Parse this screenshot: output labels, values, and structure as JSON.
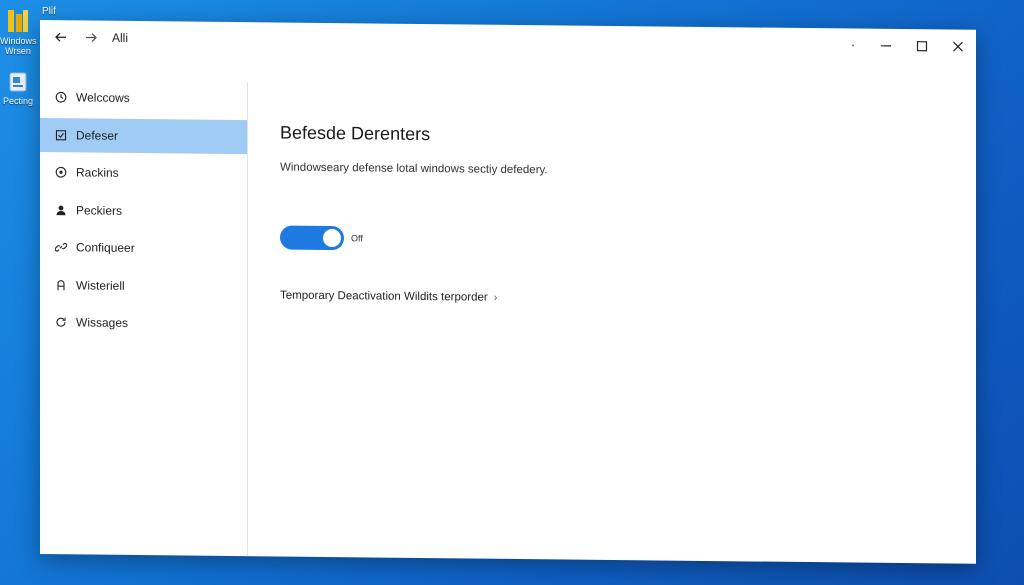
{
  "desktop": {
    "top_label": "Plif",
    "icons": [
      {
        "label": "Windows Wrsen",
        "icon": "folder-icon"
      },
      {
        "label": "Pecting",
        "icon": "file-icon"
      }
    ]
  },
  "window": {
    "title": "Alli",
    "controls": {
      "minimize": "–",
      "maximize": "☐",
      "close": "✕"
    }
  },
  "sidebar": {
    "items": [
      {
        "label": "Welccows",
        "icon": "clock-icon",
        "active": false
      },
      {
        "label": "Defeser",
        "icon": "shield-icon",
        "active": true
      },
      {
        "label": "Rackins",
        "icon": "target-icon",
        "active": false
      },
      {
        "label": "Peckiers",
        "icon": "person-icon",
        "active": false
      },
      {
        "label": "Confiqueer",
        "icon": "link-icon",
        "active": false
      },
      {
        "label": "Wisteriell",
        "icon": "lock-icon",
        "active": false
      },
      {
        "label": "Wissages",
        "icon": "refresh-icon",
        "active": false
      }
    ]
  },
  "main": {
    "title": "Befesde Derenters",
    "description": "Windowseary defense lotal windows sectiy defedery.",
    "toggle": {
      "state_label": "Off",
      "on": true
    },
    "link": {
      "label": "Temporary Deactivation Wildits terporder",
      "chevron": "›"
    }
  },
  "colors": {
    "accent": "#1e7ae0",
    "active_item": "#9fcbf4",
    "desktop": "#1378d6"
  }
}
